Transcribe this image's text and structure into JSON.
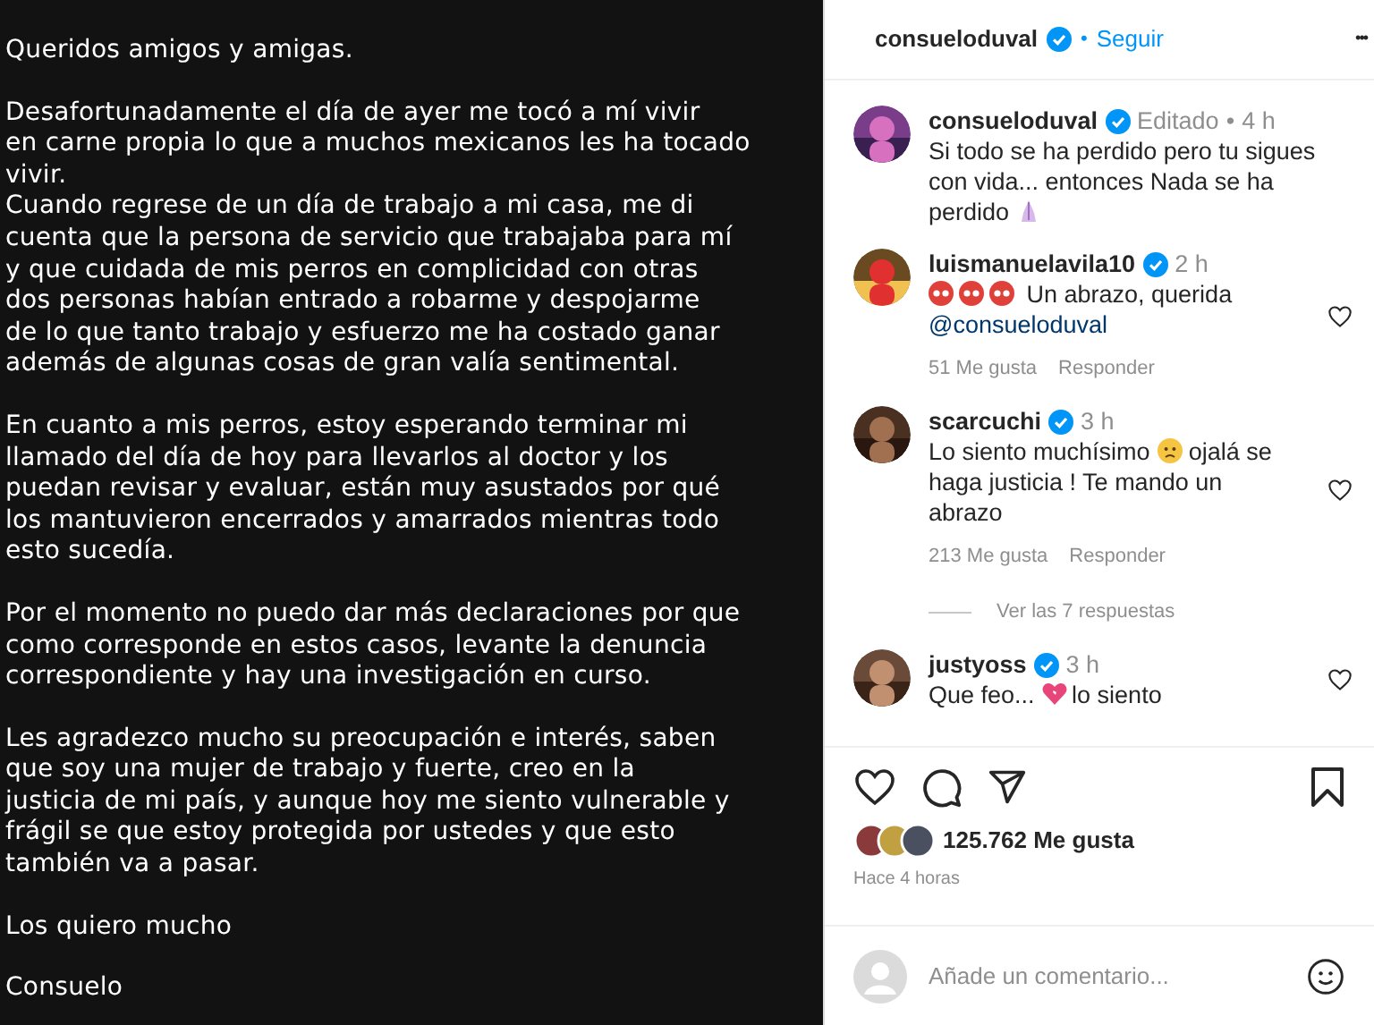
{
  "story": {
    "paragraphs": [
      "Queridos amigos y amigas.",
      "Desafortunadamente el día de ayer me tocó a mí vivir\nen carne propia lo que a muchos mexicanos les ha tocado\nvivir.\nCuando regrese de un día de trabajo a mi casa, me di\ncuenta que la persona de servicio que trabajaba para mí\ny que cuidada de mis perros en complicidad con otras\ndos personas habían entrado a robarme y despojarme\nde lo que tanto trabajo y esfuerzo me ha costado ganar\nademás de algunas cosas de gran valía sentimental.",
      "En cuanto a mis perros, estoy esperando terminar mi\nllamado del día de hoy para llevarlos al doctor y los\npuedan revisar y evaluar, están muy asustados por qué\nlos mantuvieron encerrados y amarrados mientras todo\nesto sucedía.",
      "Por el momento no puedo dar más declaraciones por que\ncomo corresponde en estos casos, levante la denuncia\ncorrespondiente y hay una investigación en curso.",
      "Les agradezco mucho su preocupación e interés, saben\nque soy una mujer de trabajo y fuerte, creo en la\njusticia de mi país, y aunque hoy me siento vulnerable y\nfrágil se que estoy protegida por ustedes y que esto\ntambién va a pasar.",
      "Los quiero mucho",
      "Consuelo"
    ]
  },
  "header": {
    "username": "consueloduval",
    "verified": true,
    "separator": "•",
    "follow": "Seguir",
    "more": "•••"
  },
  "comments": [
    {
      "kind": "caption",
      "username": "consueloduval",
      "verified": true,
      "edited": "Editado",
      "dot": "•",
      "time": "4 h",
      "parts": [
        {
          "kind": "text",
          "text": "Si todo se ha perdido pero tu sigues con vida... entonces Nada se ha perdido "
        },
        {
          "kind": "hands"
        }
      ]
    },
    {
      "kind": "comment",
      "username": "luismanuelavila10",
      "verified": true,
      "time": "2 h",
      "parts": [
        {
          "kind": "redface"
        },
        {
          "kind": "redface"
        },
        {
          "kind": "redface"
        },
        {
          "kind": "text",
          "text": " Un abrazo, querida "
        },
        {
          "kind": "mention",
          "text": "@consueloduval"
        }
      ],
      "likes": "51 Me gusta",
      "reply": "Responder",
      "liked": false
    },
    {
      "kind": "comment",
      "username": "scarcuchi",
      "verified": true,
      "time": "3 h",
      "parts": [
        {
          "kind": "text",
          "text": "Lo siento muchísimo "
        },
        {
          "kind": "sadface"
        },
        {
          "kind": "text",
          "text": " ojalá se haga justicia ! Te mando un abrazo"
        }
      ],
      "likes": "213 Me gusta",
      "reply": "Responder",
      "liked": false,
      "replies": "Ver las 7 respuestas"
    },
    {
      "kind": "comment",
      "username": "justyoss",
      "verified": true,
      "time": "3 h",
      "parts": [
        {
          "kind": "text",
          "text": "Que feo... "
        },
        {
          "kind": "brokenheart"
        },
        {
          "kind": "text",
          "text": "lo siento"
        }
      ],
      "liked": false
    }
  ],
  "likes": "125.762 Me gusta",
  "posted": "Hace 4 horas",
  "liked": false,
  "saved": false,
  "add_comment": {
    "placeholder": "Añade un comentario..."
  }
}
